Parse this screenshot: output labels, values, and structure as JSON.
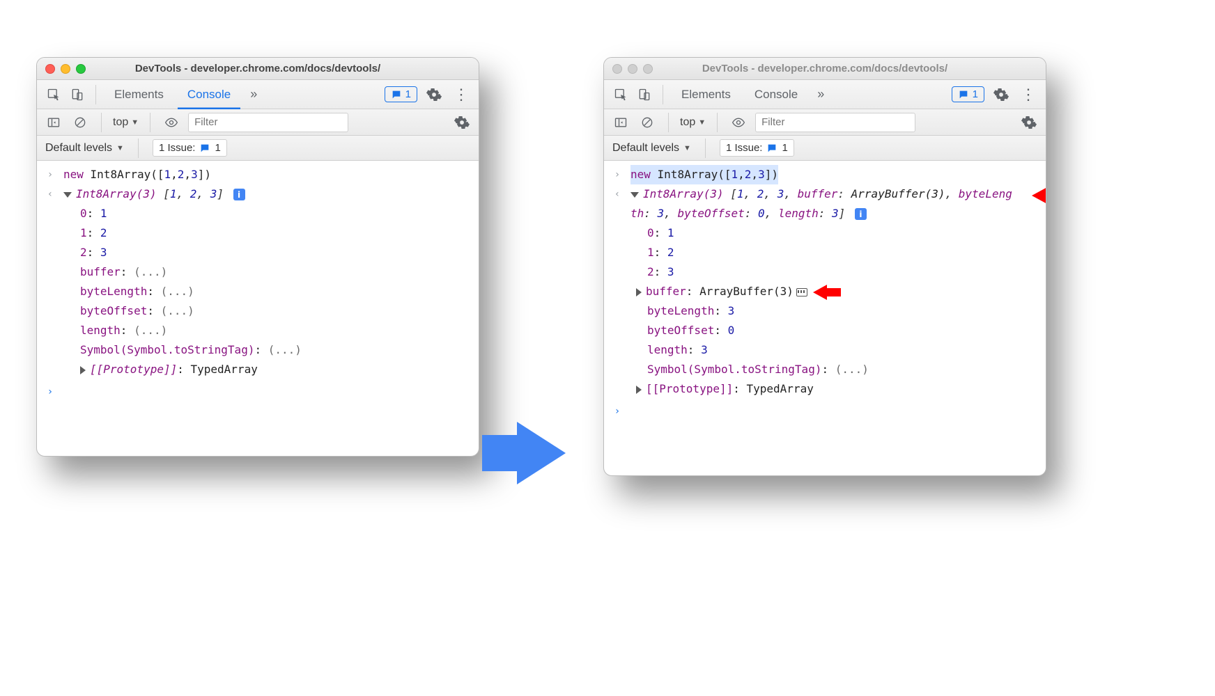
{
  "titlebar": {
    "title": "DevTools - developer.chrome.com/docs/devtools/"
  },
  "tabs": {
    "elements": "Elements",
    "console": "Console",
    "overflow": "»",
    "issue_count": "1"
  },
  "consoleToolbar": {
    "context": "top",
    "filter_placeholder": "Filter"
  },
  "levels": {
    "default_levels": "Default levels",
    "issue_label": "1 Issue:",
    "issue_count": "1"
  },
  "left": {
    "input": "new Int8Array([1,2,3])",
    "summary_type": "Int8Array(3)",
    "summary_vals": "[1, 2, 3]",
    "entries": [
      {
        "k": "0",
        "v": "1"
      },
      {
        "k": "1",
        "v": "2"
      },
      {
        "k": "2",
        "v": "3"
      }
    ],
    "props": [
      {
        "k": "buffer",
        "v": "(...)"
      },
      {
        "k": "byteLength",
        "v": "(...)"
      },
      {
        "k": "byteOffset",
        "v": "(...)"
      },
      {
        "k": "length",
        "v": "(...)"
      },
      {
        "k": "Symbol(Symbol.toStringTag)",
        "v": "(...)"
      }
    ],
    "proto_label": "[[Prototype]]",
    "proto_value": "TypedArray"
  },
  "right": {
    "input": "new Int8Array([1,2,3])",
    "summary_type": "Int8Array(3)",
    "summary_rest": "[1, 2, 3, buffer: ArrayBuffer(3), byteLength: 3, byteOffset: 0, length: 3]",
    "entries": [
      {
        "k": "0",
        "v": "1"
      },
      {
        "k": "1",
        "v": "2"
      },
      {
        "k": "2",
        "v": "3"
      }
    ],
    "buffer_key": "buffer",
    "buffer_val": "ArrayBuffer(3)",
    "props": [
      {
        "k": "byteLength",
        "v": "3"
      },
      {
        "k": "byteOffset",
        "v": "0"
      },
      {
        "k": "length",
        "v": "3"
      },
      {
        "k": "Symbol(Symbol.toStringTag)",
        "v": "(...)"
      }
    ],
    "proto_label": "[[Prototype]]",
    "proto_value": "TypedArray"
  }
}
